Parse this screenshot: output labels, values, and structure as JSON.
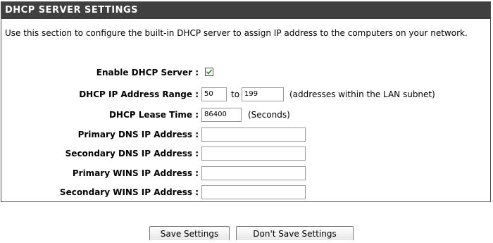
{
  "section": {
    "title": "DHCP SERVER SETTINGS",
    "description": "Use this section to configure the built-in DHCP server to assign IP address to the computers on your network."
  },
  "fields": {
    "enable_dhcp": {
      "label": "Enable DHCP Server :",
      "checked": true
    },
    "ip_range": {
      "label": "DHCP IP Address Range :",
      "start_value": "50",
      "to_text": "to",
      "end_value": "199",
      "note": "(addresses within the LAN subnet)"
    },
    "lease_time": {
      "label": "DHCP Lease Time :",
      "value": "86400",
      "unit": "(Seconds)"
    },
    "primary_dns": {
      "label": "Primary DNS IP Address :",
      "value": ""
    },
    "secondary_dns": {
      "label": "Secondary DNS IP Address :",
      "value": ""
    },
    "primary_wins": {
      "label": "Primary WINS IP Address :",
      "value": ""
    },
    "secondary_wins": {
      "label": "Secondary WINS IP Address :",
      "value": ""
    }
  },
  "buttons": {
    "save": "Save Settings",
    "dont_save": "Don't Save Settings"
  }
}
